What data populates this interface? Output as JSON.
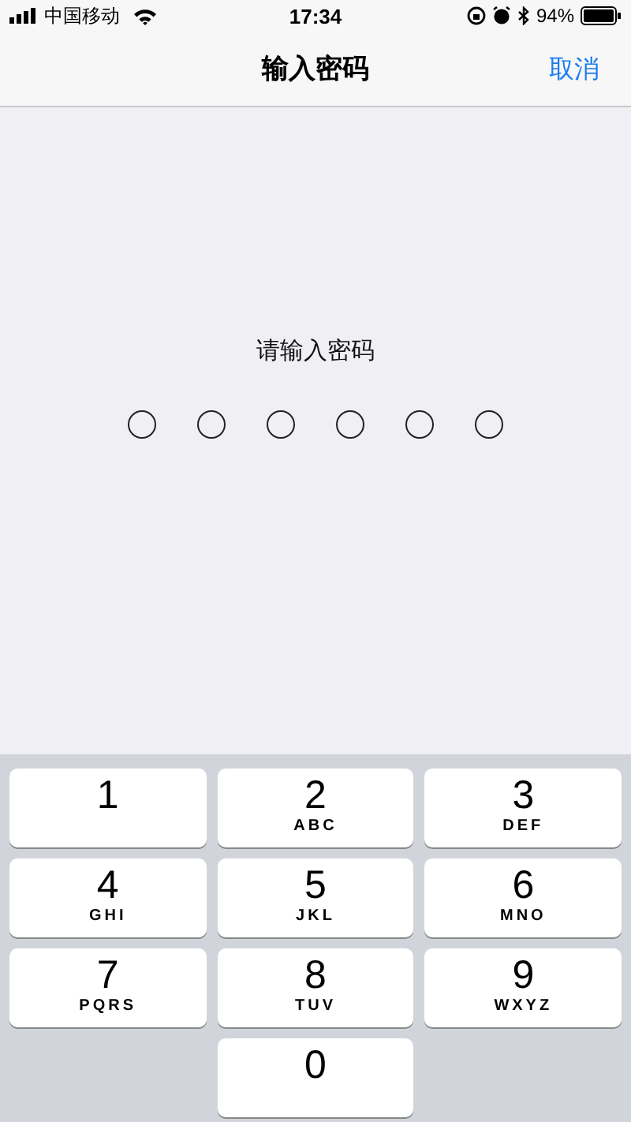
{
  "status_bar": {
    "carrier": "中国移动",
    "time": "17:34",
    "battery": "94%"
  },
  "nav": {
    "title": "输入密码",
    "cancel": "取消"
  },
  "prompt": "请输入密码",
  "pin_dots": [
    {
      "filled": false
    },
    {
      "filled": false
    },
    {
      "filled": false
    },
    {
      "filled": false
    },
    {
      "filled": false
    },
    {
      "filled": false
    }
  ],
  "keypad": [
    {
      "digit": "1"
    },
    {
      "digit": "2",
      "letters": "ABC"
    },
    {
      "digit": "3",
      "letters": "DEF"
    },
    {
      "digit": "4",
      "letters": "GHI"
    },
    {
      "digit": "5",
      "letters": "JKL"
    },
    {
      "digit": "6",
      "letters": "MNO"
    },
    {
      "digit": "7",
      "letters": "PQRS"
    },
    {
      "digit": "8",
      "letters": "TUV"
    },
    {
      "digit": "9",
      "letters": "WXYZ"
    },
    {
      "digit": "0"
    }
  ]
}
